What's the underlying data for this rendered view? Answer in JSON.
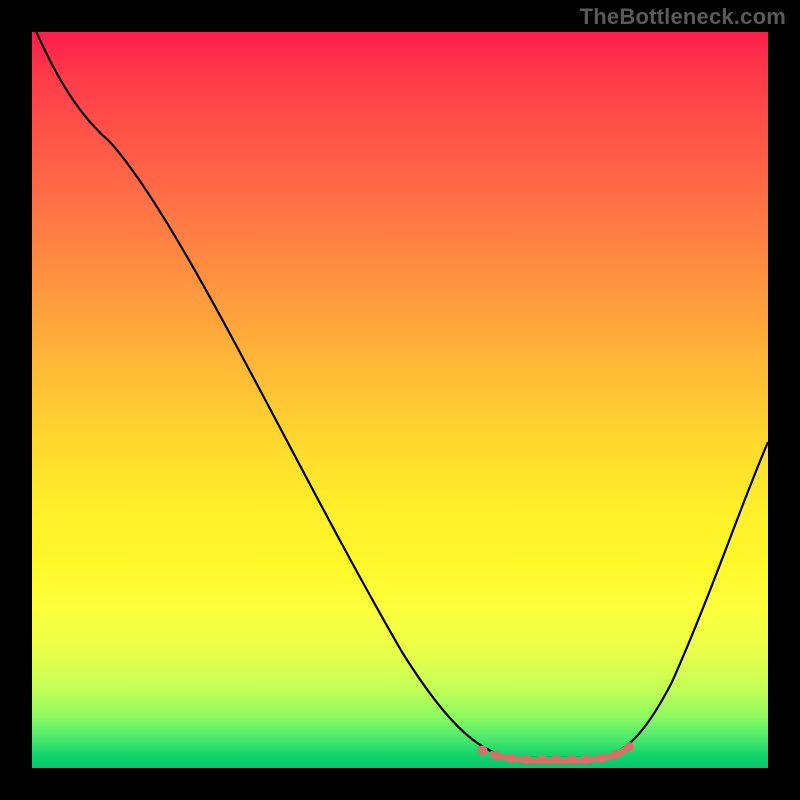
{
  "watermark": "TheBottleneck.com",
  "colors": {
    "background": "#000000",
    "curve": "#000000",
    "highlight": "#d8706a",
    "gradient_top": "#ff1d4a",
    "gradient_bottom": "#04c768"
  },
  "chart_data": {
    "type": "line",
    "title": "",
    "xlabel": "",
    "ylabel": "",
    "xlim": [
      0,
      100
    ],
    "ylim": [
      0,
      100
    ],
    "grid": false,
    "legend": false,
    "background": "vertical-gradient red→yellow→green (high→low)",
    "series": [
      {
        "name": "bottleneck-curve",
        "x": [
          0,
          5,
          10,
          20,
          30,
          40,
          50,
          55,
          60,
          65,
          70,
          75,
          80,
          85,
          90,
          95,
          100
        ],
        "values": [
          102,
          92,
          85,
          72,
          58,
          42,
          26,
          17,
          9,
          3,
          1,
          1,
          3,
          9,
          20,
          33,
          45
        ]
      }
    ],
    "annotations": [
      {
        "name": "optimal-range-highlight",
        "x_start": 61,
        "x_end": 80,
        "style": "salmon-dotted",
        "meaning": "flat minimum of curve (optimal / no bottleneck)"
      }
    ]
  }
}
